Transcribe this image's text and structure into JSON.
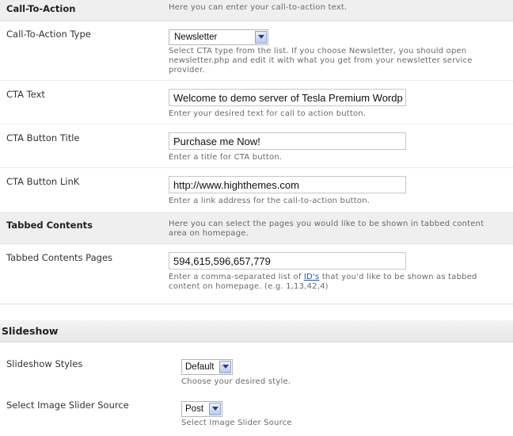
{
  "cta": {
    "section_title": "Call-To-Action",
    "section_desc": "Here you can enter your call-to-action text.",
    "type_label": "Call-To-Action Type",
    "type_value": "Newsletter",
    "type_desc_1": "Select CTA type from the list. If you choose Newsletter, you should open",
    "type_desc_2": "newsletter.php and edit it with what you get from your newsletter service",
    "type_desc_3": "provider.",
    "text_label": "CTA Text",
    "text_value": "Welcome to demo server of Tesla Premium Wordp",
    "text_desc": "Enter your desired text for call to action button.",
    "button_title_label": "CTA Button Title",
    "button_title_value": "Purchase me Now!",
    "button_title_desc": "Enter a title for CTA button.",
    "button_link_label": "CTA Button LinK",
    "button_link_value": "http://www.highthemes.com",
    "button_link_desc": "Enter a link address for the call-to-action button."
  },
  "tabbed": {
    "section_title": "Tabbed Contents",
    "section_desc_1": "Here you can select the pages you would like to be shown in tabbed content",
    "section_desc_2": "area on homepage.",
    "pages_label": "Tabbed Contents Pages",
    "pages_value": "594,615,596,657,779",
    "pages_desc_pre": "Enter a comma-separated list of ",
    "pages_desc_link": "ID's",
    "pages_desc_post": " that you'd like to be shown as tabbed",
    "pages_desc_2": "content on homepage. (e.g. 1,13,42,4)"
  },
  "slideshow": {
    "section_title": "Slideshow",
    "styles_label": "Slideshow Styles",
    "styles_value": "Default",
    "styles_desc": "Choose your desired style.",
    "source_label": "Select Image Slider Source",
    "source_value": "Post",
    "source_desc": "Select Image Slider Source"
  },
  "colors": {
    "section_band": "#efefef",
    "link": "#2255bb"
  }
}
